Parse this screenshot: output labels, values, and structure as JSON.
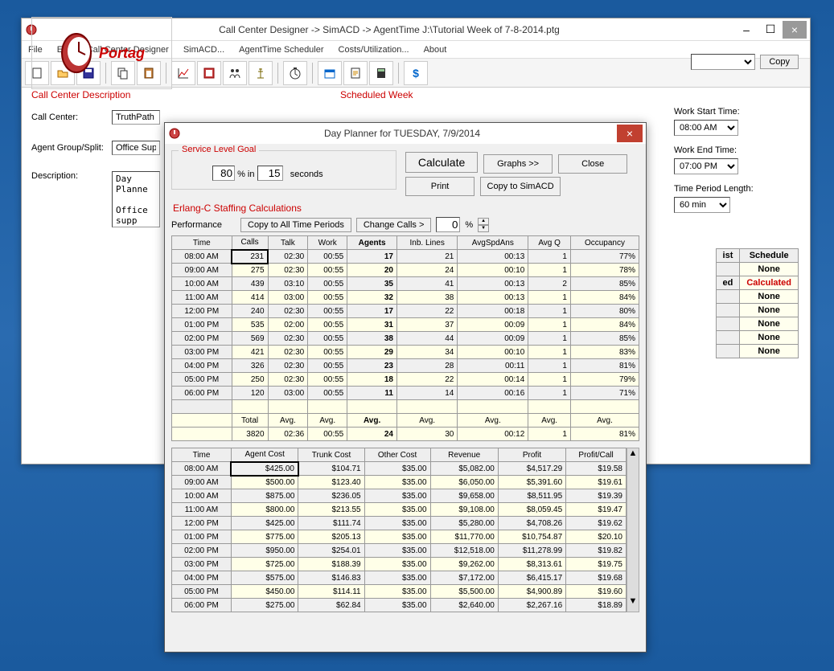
{
  "main_window": {
    "title": "Call Center Designer  ->  SimACD  ->  AgentTime      J:\\Tutorial Week of  7-8-2014.ptg",
    "menu": [
      "File",
      "Edit",
      "Call Center Designer",
      "SimACD...",
      "AgentTime Scheduler",
      "Costs/Utilization...",
      "About"
    ]
  },
  "left_panel": {
    "title": "Call Center Description",
    "call_center_label": "Call Center:",
    "call_center_value": "TruthPath I",
    "agent_group_label": "Agent Group/Split:",
    "agent_group_value": "Office Supp",
    "description_label": "Description:",
    "description_value": "Day Planne\n\nOffice supp"
  },
  "scheduled_week": {
    "title": "Scheduled Week"
  },
  "schedule_panel": {
    "work_start_label": "Work Start Time:",
    "work_start_value": "08:00 AM",
    "work_end_label": "Work End Time:",
    "work_end_value": "07:00 PM",
    "time_period_label": "Time Period Length:",
    "time_period_value": "60 min",
    "copy_label": "Copy",
    "headers": [
      "ist",
      "Schedule"
    ],
    "rows": [
      {
        "label": "",
        "value": "None"
      },
      {
        "label": "ed",
        "value": "Calculated"
      },
      {
        "label": "",
        "value": "None"
      },
      {
        "label": "",
        "value": "None"
      },
      {
        "label": "",
        "value": "None"
      },
      {
        "label": "",
        "value": "None"
      },
      {
        "label": "",
        "value": "None"
      }
    ]
  },
  "logo_text": "Portag",
  "modal": {
    "title": "Day Planner for TUESDAY,  7/9/2014",
    "service_level_label": "Service Level Goal",
    "sl_percent": "80",
    "sl_pct_label": "%  in",
    "sl_seconds": "15",
    "sl_sec_label": "seconds",
    "buttons": {
      "calculate": "Calculate",
      "graphs": "Graphs >>",
      "close": "Close",
      "print": "Print",
      "copy_sim": "Copy to SimACD"
    },
    "erlang_label": "Erlang-C Staffing Calculations",
    "performance_label": "Performance",
    "copy_all_btn": "Copy to All Time Periods",
    "change_calls_btn": "Change Calls >",
    "change_calls_value": "0",
    "change_calls_pct": "%"
  },
  "staffing_table": {
    "headers": [
      "Time",
      "Calls",
      "Talk",
      "Work",
      "Agents",
      "Inb. Lines",
      "AvgSpdAns",
      "Avg Q",
      "Occupancy"
    ],
    "rows": [
      [
        "08:00 AM",
        "231",
        "02:30",
        "00:55",
        "17",
        "21",
        "00:13",
        "1",
        "77%"
      ],
      [
        "09:00 AM",
        "275",
        "02:30",
        "00:55",
        "20",
        "24",
        "00:10",
        "1",
        "78%"
      ],
      [
        "10:00 AM",
        "439",
        "03:10",
        "00:55",
        "35",
        "41",
        "00:13",
        "2",
        "85%"
      ],
      [
        "11:00 AM",
        "414",
        "03:00",
        "00:55",
        "32",
        "38",
        "00:13",
        "1",
        "84%"
      ],
      [
        "12:00 PM",
        "240",
        "02:30",
        "00:55",
        "17",
        "22",
        "00:18",
        "1",
        "80%"
      ],
      [
        "01:00 PM",
        "535",
        "02:00",
        "00:55",
        "31",
        "37",
        "00:09",
        "1",
        "84%"
      ],
      [
        "02:00 PM",
        "569",
        "02:30",
        "00:55",
        "38",
        "44",
        "00:09",
        "1",
        "85%"
      ],
      [
        "03:00 PM",
        "421",
        "02:30",
        "00:55",
        "29",
        "34",
        "00:10",
        "1",
        "83%"
      ],
      [
        "04:00 PM",
        "326",
        "02:30",
        "00:55",
        "23",
        "28",
        "00:11",
        "1",
        "81%"
      ],
      [
        "05:00 PM",
        "250",
        "02:30",
        "00:55",
        "18",
        "22",
        "00:14",
        "1",
        "79%"
      ],
      [
        "06:00 PM",
        "120",
        "03:00",
        "00:55",
        "11",
        "14",
        "00:16",
        "1",
        "71%"
      ]
    ],
    "total_row": [
      "",
      "Total",
      "Avg.",
      "Avg.",
      "Avg.",
      "Avg.",
      "Avg.",
      "Avg.",
      "Avg."
    ],
    "avg_row": [
      "",
      "3820",
      "02:36",
      "00:55",
      "24",
      "30",
      "00:12",
      "1",
      "81%"
    ]
  },
  "cost_table": {
    "headers": [
      "Time",
      "Agent Cost",
      "Trunk Cost",
      "Other Cost",
      "Revenue",
      "Profit",
      "Profit/Call"
    ],
    "rows": [
      [
        "08:00 AM",
        "$425.00",
        "$104.71",
        "$35.00",
        "$5,082.00",
        "$4,517.29",
        "$19.58"
      ],
      [
        "09:00 AM",
        "$500.00",
        "$123.40",
        "$35.00",
        "$6,050.00",
        "$5,391.60",
        "$19.61"
      ],
      [
        "10:00 AM",
        "$875.00",
        "$236.05",
        "$35.00",
        "$9,658.00",
        "$8,511.95",
        "$19.39"
      ],
      [
        "11:00 AM",
        "$800.00",
        "$213.55",
        "$35.00",
        "$9,108.00",
        "$8,059.45",
        "$19.47"
      ],
      [
        "12:00 PM",
        "$425.00",
        "$111.74",
        "$35.00",
        "$5,280.00",
        "$4,708.26",
        "$19.62"
      ],
      [
        "01:00 PM",
        "$775.00",
        "$205.13",
        "$35.00",
        "$11,770.00",
        "$10,754.87",
        "$20.10"
      ],
      [
        "02:00 PM",
        "$950.00",
        "$254.01",
        "$35.00",
        "$12,518.00",
        "$11,278.99",
        "$19.82"
      ],
      [
        "03:00 PM",
        "$725.00",
        "$188.39",
        "$35.00",
        "$9,262.00",
        "$8,313.61",
        "$19.75"
      ],
      [
        "04:00 PM",
        "$575.00",
        "$146.83",
        "$35.00",
        "$7,172.00",
        "$6,415.17",
        "$19.68"
      ],
      [
        "05:00 PM",
        "$450.00",
        "$114.11",
        "$35.00",
        "$5,500.00",
        "$4,900.89",
        "$19.60"
      ],
      [
        "06:00 PM",
        "$275.00",
        "$62.84",
        "$35.00",
        "$2,640.00",
        "$2,267.16",
        "$18.89"
      ]
    ]
  }
}
